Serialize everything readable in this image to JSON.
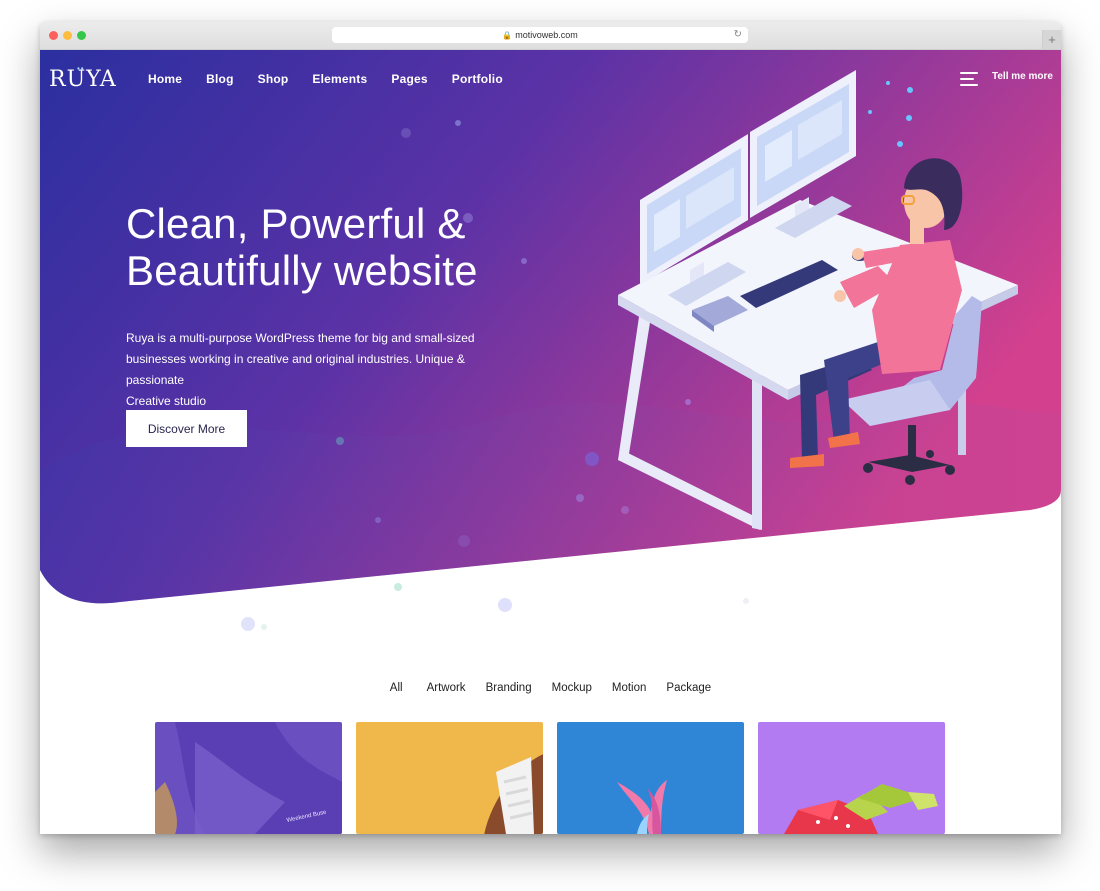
{
  "browser": {
    "url": "motivoweb.com"
  },
  "brand": {
    "logo": "RUYA"
  },
  "nav": {
    "items": [
      "Home",
      "Blog",
      "Shop",
      "Elements",
      "Pages",
      "Portfolio"
    ],
    "tell_me_more": "Tell me more"
  },
  "hero": {
    "title_line1": "Clean, Powerful &",
    "title_line2": "Beautifully website",
    "description_line1": "Ruya is a multi-purpose WordPress theme for big and small-sized",
    "description_line2": "businesses working in creative and original industries. Unique & passionate",
    "description_line3": "Creative studio",
    "cta": "Discover More"
  },
  "portfolio": {
    "filters": [
      "All",
      "Artwork",
      "Branding",
      "Mockup",
      "Motion",
      "Package"
    ],
    "cards": [
      {
        "name": "portfolio-card-purple-jacket",
        "bg": "#6a4fc1"
      },
      {
        "name": "portfolio-card-football",
        "bg": "#f0b84a"
      },
      {
        "name": "portfolio-card-pineapple",
        "bg": "#2f86d6"
      },
      {
        "name": "portfolio-card-strawberry",
        "bg": "#b27bf2"
      }
    ]
  },
  "colors": {
    "gradient_start": "#2e2fa3",
    "gradient_mid": "#6b32a6",
    "gradient_end": "#d13f8f"
  }
}
